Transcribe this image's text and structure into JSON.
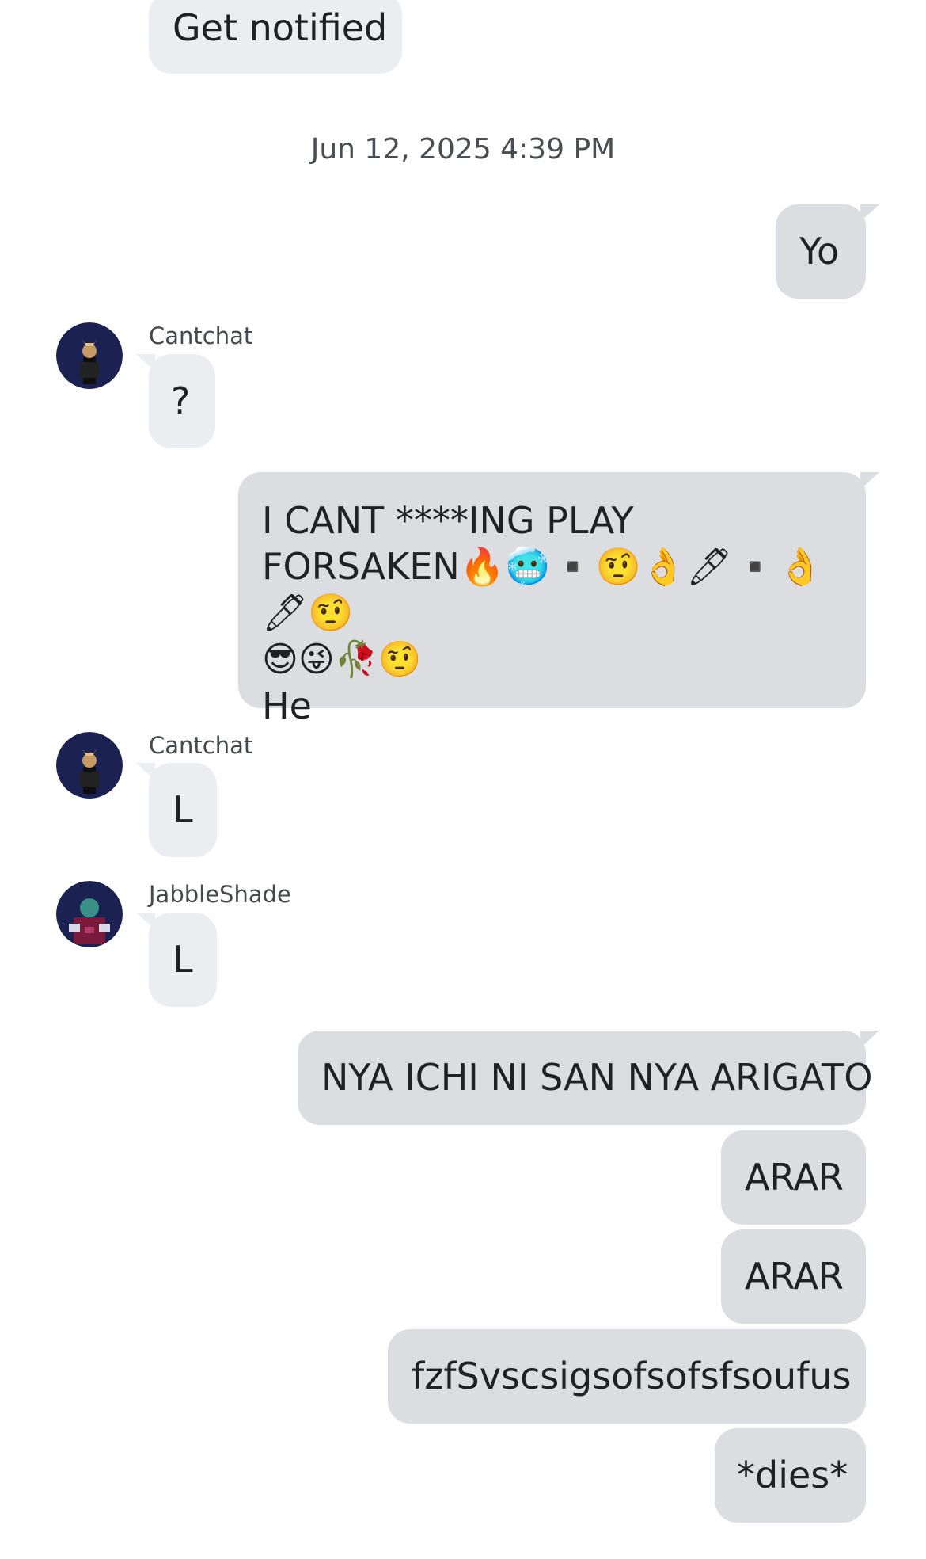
{
  "messages": {
    "top_bubble": "Get notified",
    "timestamp": "Jun 12, 2025 4:39 PM",
    "out_1": "Yo",
    "in_1_sender": "Cantchat",
    "in_1_text": "?",
    "out_2_line1": "I CANT ****ING PLAY",
    "out_2_line2": "FORSAKEN🔥🥶▪️🤨👌🖊▪️👌🖊🤨",
    "out_2_line3": "😎😜🥀🤨",
    "out_2_line4": "He",
    "in_2_sender": "Cantchat",
    "in_2_text": "L",
    "in_3_sender": "JabbleShade",
    "in_3_text": "L",
    "out_3": "NYA ICHI NI SAN NYA ARIGATO",
    "out_4": "ARAR",
    "out_5": "ARAR",
    "out_6": "fzfSvscsigsofsofsfsoufus",
    "out_7": "*dies*"
  },
  "avatars": {
    "cantchat": "avatar-cantchat",
    "jabbleshade": "avatar-jabbleshade"
  },
  "colors": {
    "bubble_out": "#dcdde1",
    "bubble_in": "#ecedf0",
    "avatar_bg": "#1b2150"
  }
}
